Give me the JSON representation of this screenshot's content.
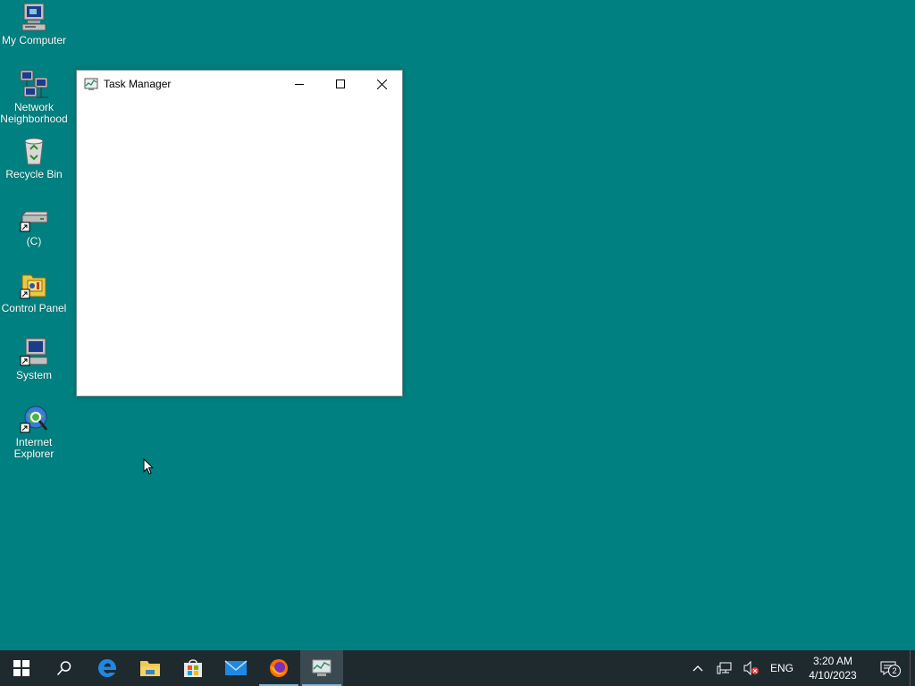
{
  "desktop": {
    "background": "#008080",
    "icons": [
      {
        "label": "My Computer"
      },
      {
        "label": "Network\nNeighborhood"
      },
      {
        "label": "Recycle Bin"
      },
      {
        "label": "(C)"
      },
      {
        "label": "Control Panel"
      },
      {
        "label": "System"
      },
      {
        "label": "Internet\nExplorer"
      }
    ]
  },
  "window": {
    "title": "Task Manager",
    "minimize_icon": "minimize-icon",
    "maximize_icon": "maximize-icon",
    "close_icon": "close-icon"
  },
  "taskbar": {
    "background": "#1f2a2e",
    "buttons": [
      "start",
      "search",
      "edge",
      "file-explorer",
      "store",
      "mail",
      "firefox",
      "task-manager"
    ],
    "tray": {
      "language": "ENG",
      "time": "3:20 AM",
      "date": "4/10/2023",
      "notification_count": "2"
    }
  }
}
